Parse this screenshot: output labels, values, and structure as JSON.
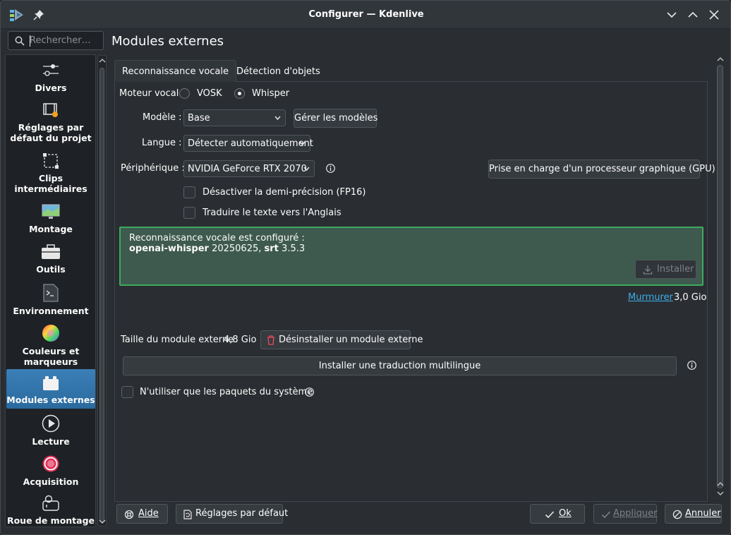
{
  "window": {
    "title": "Configurer — Kdenlive"
  },
  "search": {
    "placeholder": "Rechercher…"
  },
  "sidebar": {
    "items": [
      {
        "label": "Divers",
        "icon": "sliders-icon"
      },
      {
        "label": "Réglages par défaut du projet",
        "icon": "film-settings-icon"
      },
      {
        "label": "Clips intermédiaires",
        "icon": "proxy-clip-icon"
      },
      {
        "label": "Montage",
        "icon": "monitor-icon"
      },
      {
        "label": "Outils",
        "icon": "toolbox-icon"
      },
      {
        "label": "Environnement",
        "icon": "terminal-icon"
      },
      {
        "label": "Couleurs et marqueurs",
        "icon": "color-wheel-icon"
      },
      {
        "label": "Modules externes",
        "icon": "plugin-icon",
        "active": true
      },
      {
        "label": "Lecture",
        "icon": "play-icon"
      },
      {
        "label": "Acquisition",
        "icon": "record-icon"
      },
      {
        "label": "Roue de montage",
        "icon": "jog-wheel-icon"
      }
    ]
  },
  "page": {
    "title": "Modules externes"
  },
  "tabs": [
    {
      "label": "Reconnaissance vocale",
      "active": true
    },
    {
      "label": "Détection d'objets",
      "active": false
    }
  ],
  "speech": {
    "engine_label": "Moteur vocal",
    "engine_options": [
      "VOSK",
      "Whisper"
    ],
    "engine_selected": "Whisper",
    "model_label": "Modèle :",
    "model_value": "Base",
    "manage_models": "Gérer les modèles",
    "language_label": "Langue :",
    "language_value": "Détecter automatiquement",
    "device_label": "Périphérique :",
    "device_value": "NVIDIA GeForce RTX 2070",
    "gpu_button": "Prise en charge d'un processeur graphique (GPU)",
    "fp16_label": "Désactiver la demi-précision (FP16)",
    "fp16_checked": false,
    "translate_label": "Traduire le texte vers l'Anglais",
    "translate_checked": false
  },
  "status_box": {
    "line1": "Reconnaissance vocale est configuré :",
    "pkg1": "openai-whisper",
    "ver1": "20250625,",
    "pkg2": "srt",
    "ver2": "3.5.3",
    "install_button": "Installer"
  },
  "model_link": {
    "label": "Murmurer",
    "size": "3,0 Gio"
  },
  "module": {
    "size_label": "Taille du module externe",
    "size_value": "4,8 Gio",
    "uninstall_button": "Désinstaller un module externe",
    "multilingual_button": "Installer une traduction multilingue",
    "system_packages_label": "N'utiliser que les paquets du système",
    "system_packages_checked": false
  },
  "footer": {
    "help": "Aide",
    "defaults": "Réglages par défaut",
    "ok": "Ok",
    "apply": "Appliquer",
    "cancel": "Annuler"
  },
  "colors": {
    "accent": "#3daee9",
    "status_border": "#3daa5f",
    "active_item": "#2a6a9e"
  }
}
